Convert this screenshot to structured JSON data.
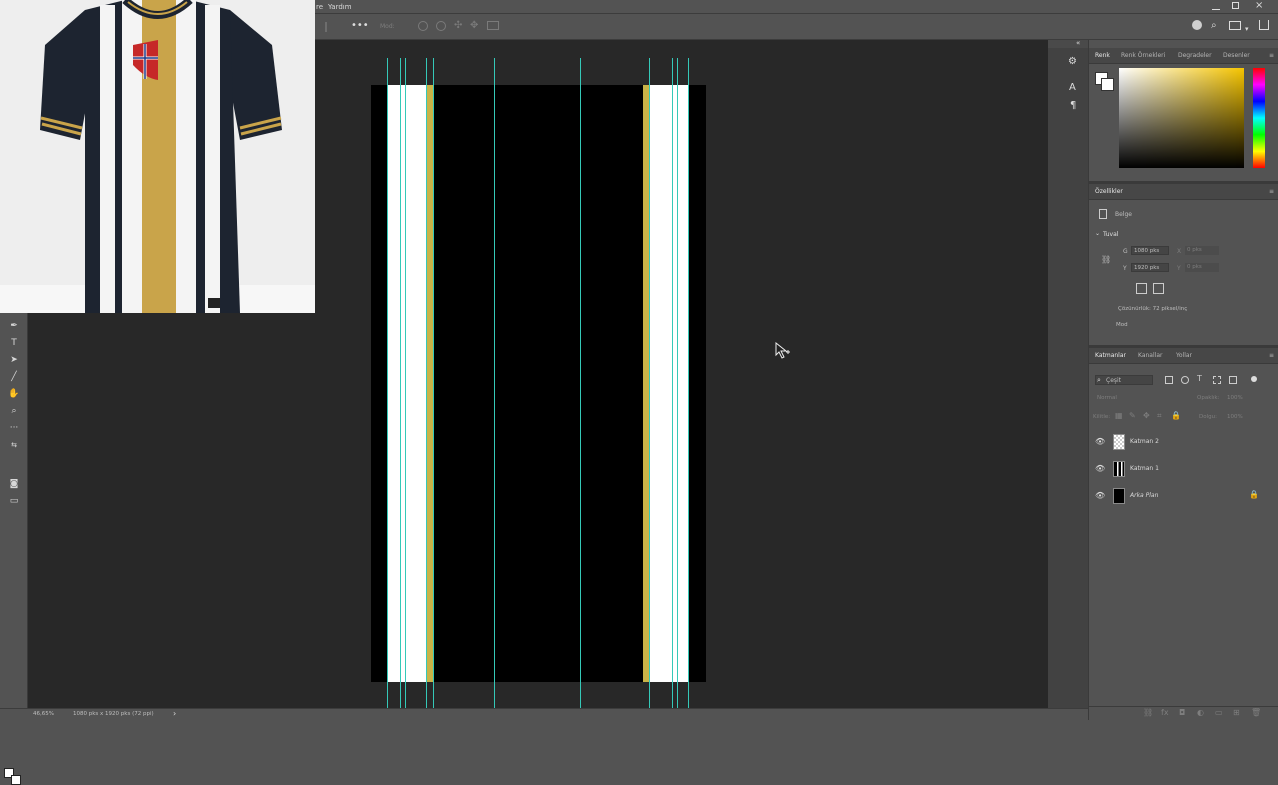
{
  "menu": {
    "items": [
      "re",
      "Yardım"
    ]
  },
  "options": {
    "mode_label": "Mod:"
  },
  "document": {
    "zoom": "46,65%",
    "size_info": "1080 pks x 1920 pks (72 ppi)"
  },
  "swatches_panel": {
    "tabs": [
      "Renk",
      "Renk Örnekleri",
      "Degradeler",
      "Desenler"
    ]
  },
  "properties": {
    "title": "Özellikler",
    "section_doc": "Belge",
    "section_canvas": "Tuval",
    "w_label": "G",
    "w_value": "1080 pks",
    "h_label": "Y",
    "h_value": "1920 pks",
    "x_label": "X",
    "x_value": "0 pks",
    "y_label": "Y",
    "y_value": "0 pks",
    "resolution": "Çözünürlük: 72 piksel/inç",
    "mode": "Mod"
  },
  "layers_panel": {
    "tabs": [
      "Katmanlar",
      "Kanallar",
      "Yollar"
    ],
    "filter": "Çeşit",
    "blend": "Normal",
    "opacity_label": "Opaklık:",
    "opacity": "100%",
    "lock_label": "Kilitle:",
    "fill_label": "Dolgu:",
    "fill": "100%",
    "layers": [
      {
        "name": "Katman 2"
      },
      {
        "name": "Katman 1"
      },
      {
        "name": "Arka Plan"
      }
    ]
  },
  "colors": {
    "stripe_gold": "#c9b347",
    "stripe_white": "#ffffff",
    "guide": "#35c9b8",
    "canvas": "#000000",
    "workspace": "#282828"
  },
  "icons": [
    "pen-icon",
    "type-icon",
    "path-select-icon",
    "line-icon",
    "hand-icon",
    "zoom-icon",
    "more-icon",
    "swap-colors-icon",
    "quick-mask-icon",
    "screen-mode-icon",
    "eye-icon",
    "lock-icon",
    "search-icon",
    "cursor-icon"
  ]
}
